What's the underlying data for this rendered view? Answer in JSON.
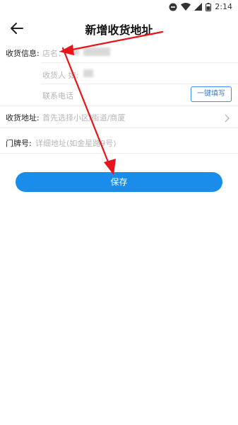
{
  "status": {
    "time": "2:14"
  },
  "header": {
    "title": "新增收货地址"
  },
  "form": {
    "contact_label": "收货信息:",
    "shop_name_placeholder": "店名：",
    "receiver_placeholder": "收货人 如:",
    "phone_placeholder": "联系电话",
    "quick_fill_label": "一键填写",
    "address_label": "收货地址:",
    "address_placeholder": "首先选择小区/街道/商厦",
    "door_label": "门牌号:",
    "door_placeholder": "详细地址(如金星路9号)"
  },
  "actions": {
    "save_label": "保存"
  },
  "colors": {
    "accent": "#1a8ce9",
    "annotation_red": "#e8141c"
  }
}
